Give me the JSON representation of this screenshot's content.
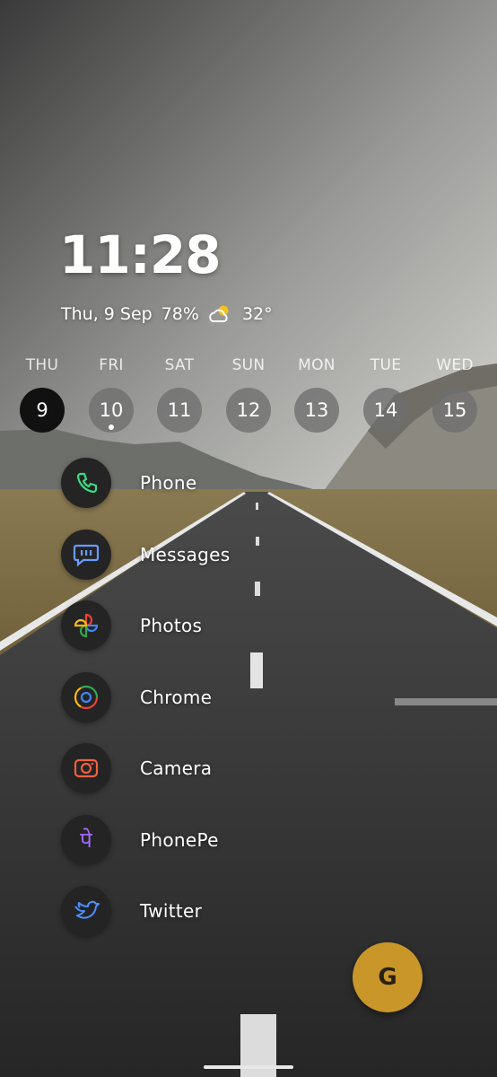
{
  "clock": {
    "time": "11:28"
  },
  "info": {
    "date": "Thu, 9 Sep",
    "battery": "78%",
    "temperature": "32°",
    "weather_icon": "partly-sunny-icon"
  },
  "week": [
    {
      "name": "THU",
      "num": "9",
      "today": true
    },
    {
      "name": "FRI",
      "num": "10",
      "event": true
    },
    {
      "name": "SAT",
      "num": "11"
    },
    {
      "name": "SUN",
      "num": "12"
    },
    {
      "name": "MON",
      "num": "13"
    },
    {
      "name": "TUE",
      "num": "14"
    },
    {
      "name": "WED",
      "num": "15"
    }
  ],
  "apps": [
    {
      "label": "Phone",
      "icon": "phone-icon",
      "color": "#3ddc84"
    },
    {
      "label": "Messages",
      "icon": "messages-icon",
      "color": "#6b9bff"
    },
    {
      "label": "Photos",
      "icon": "photos-icon",
      "color": "#fbbc04"
    },
    {
      "label": "Chrome",
      "icon": "chrome-icon",
      "color": "#ea4335"
    },
    {
      "label": "Camera",
      "icon": "camera-icon",
      "color": "#f06040"
    },
    {
      "label": "PhonePe",
      "icon": "phonepe-icon",
      "color": "#a66cff"
    },
    {
      "label": "Twitter",
      "icon": "twitter-icon",
      "color": "#4d8fff"
    }
  ],
  "assistant": {
    "label": "G",
    "color": "#c9962a"
  }
}
